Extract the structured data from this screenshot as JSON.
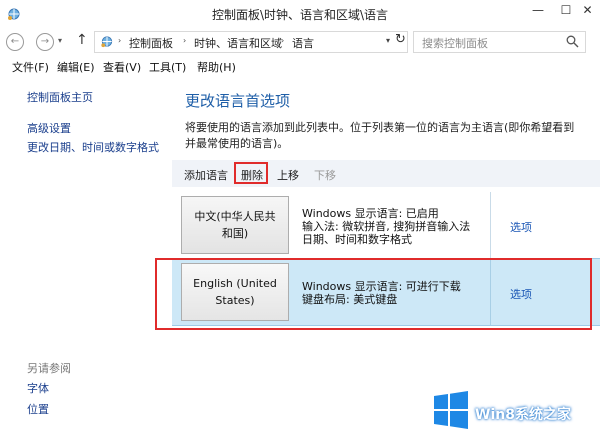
{
  "window": {
    "title": "控制面板\\时钟、语言和区域\\语言",
    "minimize": "—",
    "maximize": "☐",
    "close": "✕"
  },
  "nav": {
    "back": "←",
    "forward": "→",
    "up": "↑",
    "breadcrumbs": [
      "控制面板",
      "时钟、语言和区域",
      "语言"
    ],
    "separator": "›",
    "refresh": "↻",
    "search_placeholder": "搜索控制面板"
  },
  "menu": [
    "文件(F)",
    "编辑(E)",
    "查看(V)",
    "工具(T)",
    "帮助(H)"
  ],
  "sidebar": {
    "home": "控制面板主页",
    "links": [
      "高级设置",
      "更改日期、时间或数字格式"
    ],
    "see_also_title": "另请参阅",
    "see_also": [
      "字体",
      "位置"
    ]
  },
  "main": {
    "title": "更改语言首选项",
    "description": "将要使用的语言添加到此列表中。位于列表第一位的语言为主语言(即你希望看到并最常使用的语言)。",
    "toolbar": {
      "add": "添加语言",
      "delete": "删除",
      "up": "上移",
      "down": "下移"
    },
    "languages": [
      {
        "name_line1": "中文(中华人民共",
        "name_line2": "和国)",
        "info": [
          "Windows 显示语言: 已启用",
          "输入法: 微软拼音, 搜狗拼音输入法",
          "日期、时间和数字格式"
        ],
        "options": "选项"
      },
      {
        "name_line1": "English (United",
        "name_line2": "States)",
        "info": [
          "Windows 显示语言: 可进行下载",
          "键盘布局: 美式键盘"
        ],
        "options": "选项"
      }
    ]
  },
  "watermark": {
    "text": "Win8系统之家"
  },
  "colors": {
    "accent": "#1f5fa8",
    "link": "#1a56b5",
    "selected_row": "#cde8f7",
    "highlight_red": "#e02b2b"
  }
}
